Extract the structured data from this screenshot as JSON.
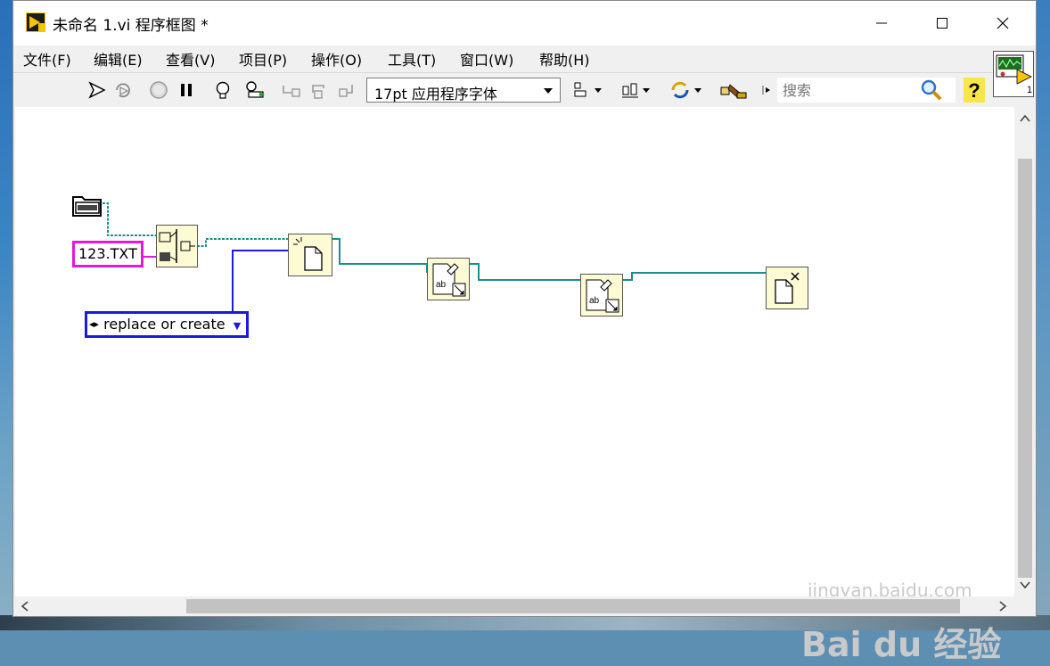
{
  "window": {
    "title": "未命名 1.vi 程序框图 *",
    "app_icon": "labview-vi-icon",
    "controls": [
      "minimize-icon",
      "maximize-icon",
      "close-icon"
    ]
  },
  "menu": {
    "items": [
      {
        "label": "文件(F)"
      },
      {
        "label": "编辑(E)"
      },
      {
        "label": "查看(V)"
      },
      {
        "label": "项目(P)"
      },
      {
        "label": "操作(O)"
      },
      {
        "label": "工具(T)"
      },
      {
        "label": "窗口(W)"
      },
      {
        "label": "帮助(H)"
      }
    ]
  },
  "toolbar": {
    "font_select_value": "17pt 应用程序字体",
    "search_placeholder": "搜索",
    "icons": [
      "run-arrow-icon",
      "run-continuously-icon",
      "abort-icon",
      "pause-icon",
      "highlight-execution-icon",
      "retain-wire-values-icon",
      "step-into-icon",
      "step-over-icon",
      "step-out-icon",
      "align-objects-icon",
      "distribute-objects-icon",
      "reorder-icon",
      "clean-up-diagram-icon",
      "search-icon",
      "help-icon"
    ]
  },
  "vi_icon": {
    "connector_label": "1"
  },
  "diagram": {
    "string_constant": "123.TXT",
    "enum_constant": "replace or create",
    "nodes": [
      "folder-path-constant",
      "build-path-node",
      "open-create-file-node",
      "write-text-file-node-1",
      "write-text-file-node-2",
      "close-file-node"
    ],
    "colors": {
      "wire_refnum": "#1a8f8f",
      "wire_string": "#e11ad8",
      "wire_enum": "#1a1ad8",
      "node_fill": "#fdfbd4"
    }
  },
  "watermark": {
    "brand": "Bai du 经验",
    "url": "jingyan.baidu.com"
  }
}
